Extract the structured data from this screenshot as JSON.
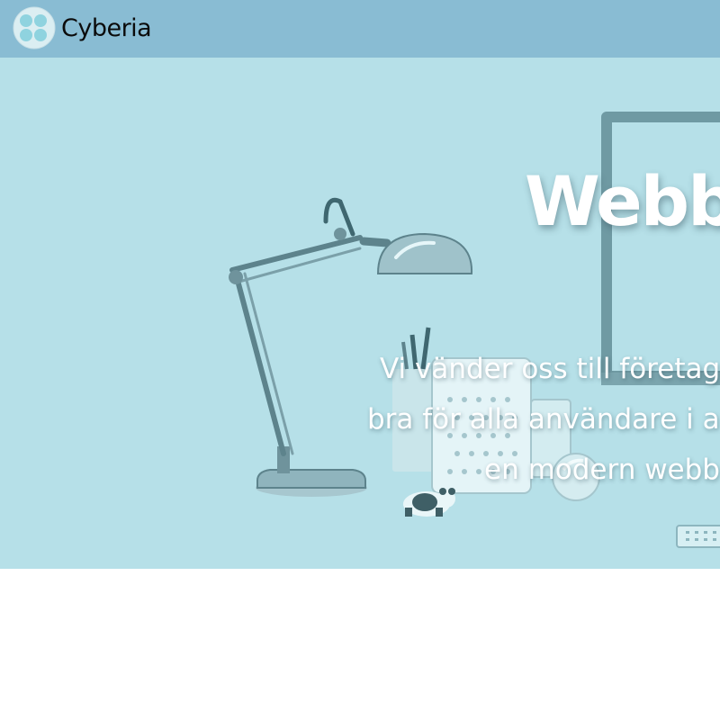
{
  "brand": {
    "name": "Cyberia",
    "logo_icon": "four-dot-circle-logo-icon",
    "colors": {
      "header_bg": "#89bcd3",
      "hero_bg": "#b6e0e8",
      "logo_dots": "#8fd3df",
      "logo_ring": "#dbeef2"
    }
  },
  "hero": {
    "title": "Webby",
    "lines": [
      "Vi vänder oss till företag",
      "bra för alla användare i a",
      "en modern webb"
    ],
    "background_image": "desk-with-lamp-monitor-and-panda-figurine"
  }
}
